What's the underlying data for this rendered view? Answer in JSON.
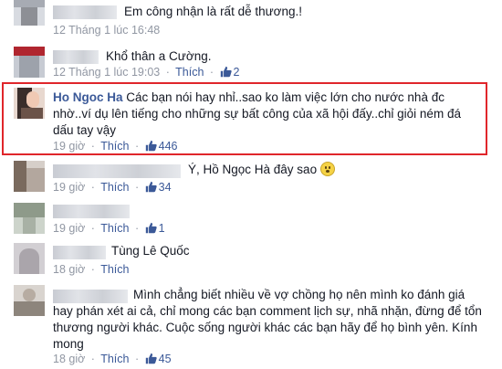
{
  "comments": [
    {
      "text": "Em công nhận là rất dễ thương.!",
      "time": "12 Tháng 1 lúc 16:48",
      "like": "Thích"
    },
    {
      "text": "Khổ thân a Cường.",
      "time": "12 Tháng 1 lúc 19:03",
      "like": "Thích",
      "likes": "2"
    },
    {
      "name": "Ho Ngoc Ha",
      "line1": "Các bạn nói hay nhỉ..sao ko làm việc lớn cho nước nhà đc",
      "line2": "nhờ..ví dụ lên tiếng cho những sự bất công của xã hội đấy..chỉ giỏi ném đá",
      "line3": "dấu tay vậy",
      "time": "19 giờ",
      "like": "Thích",
      "likes": "446"
    },
    {
      "text": "Ý, Hồ Ngọc Hà đây sao",
      "time": "19 giờ",
      "like": "Thích",
      "likes": "34"
    },
    {
      "time": "19 giờ",
      "like": "Thích",
      "likes": "1"
    },
    {
      "text": "Tùng Lê Quốc",
      "time": "18 giờ",
      "like": "Thích"
    },
    {
      "line1": "Mình chẳng biết nhiều về vợ chồng họ nên mình ko đánh giá",
      "line2": "hay phán xét ai cả, chỉ mong các bạn comment lịch sự, nhã nhặn, đừng để tổn",
      "line3": "thương người khác. Cuộc sống người khác các bạn hãy để họ bình yên. Kính",
      "line4": "mong",
      "time": "18 giờ",
      "like": "Thích",
      "likes": "45"
    }
  ],
  "separator": "·",
  "icons": {
    "like": "thumbs-up-icon",
    "emoji": "surprised-face-icon"
  },
  "colors": {
    "link": "#3b5998",
    "meta": "#9197a3",
    "highlight": "#e0262b"
  }
}
